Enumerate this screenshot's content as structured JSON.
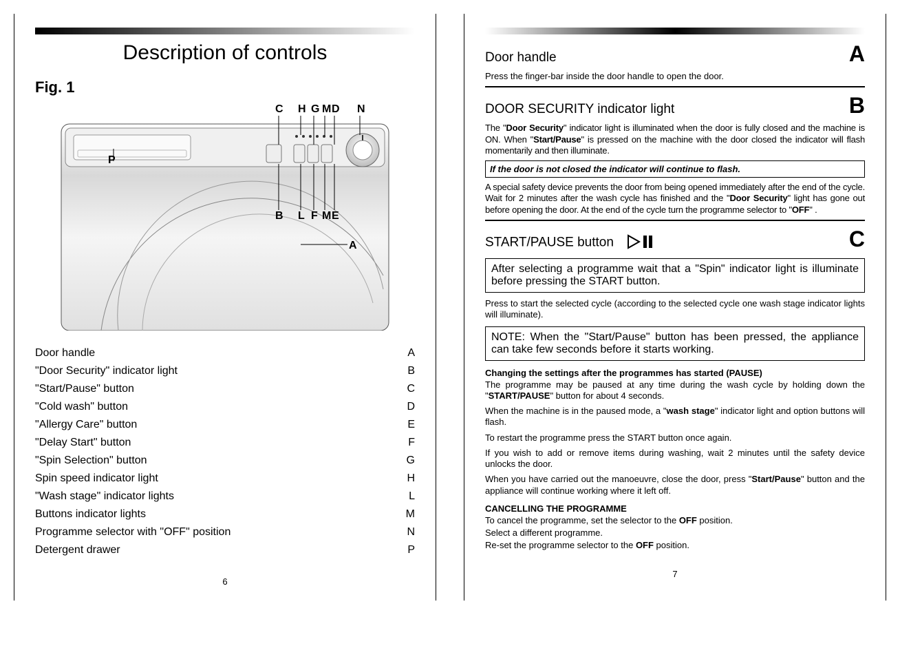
{
  "left": {
    "title": "Description of controls",
    "fig": "Fig. 1",
    "callouts_top": [
      "C",
      "H",
      "G",
      "M",
      "D",
      "N"
    ],
    "callouts_bottom": [
      "B",
      "L",
      "F",
      "M",
      "E"
    ],
    "callout_p": "P",
    "callout_a": "A",
    "legend": [
      {
        "label": "Door handle",
        "k": "A"
      },
      {
        "label": "\"Door Security\" indicator light",
        "k": "B"
      },
      {
        "label": "\"Start/Pause\" button",
        "k": "C"
      },
      {
        "label": "\"Cold wash\" button",
        "k": "D"
      },
      {
        "label": "\"Allergy Care\" button",
        "k": "E"
      },
      {
        "label": "\"Delay Start\" button",
        "k": "F"
      },
      {
        "label": "\"Spin Selection\" button",
        "k": "G"
      },
      {
        "label": "Spin speed indicator light",
        "k": "H"
      },
      {
        "label": "\"Wash stage\" indicator lights",
        "k": "L"
      },
      {
        "label": "Buttons indicator lights",
        "k": "M"
      },
      {
        "label": "Programme selector with \"OFF\" position",
        "k": "N"
      },
      {
        "label": "Detergent drawer",
        "k": "P"
      }
    ],
    "pagenum": "6"
  },
  "right": {
    "sectionA": {
      "title": "Door handle",
      "letter": "A",
      "text": "Press the finger-bar inside the door handle to open the door."
    },
    "sectionB": {
      "title": "DOOR SECURITY indicator light",
      "letter": "B",
      "para1_a": "The \"",
      "para1_b": "Door Security",
      "para1_c": "\" indicator light is illuminated when the door is fully closed and the machine is ON. When \"",
      "para1_d": "Start/Pause",
      "para1_e": "\" is pressed on the machine with the door closed the indicator will flash momentarily and then illuminate.",
      "boxnote": "If the door is not closed the indicator will continue to flash.",
      "para2_a": "A special safety device prevents the door from being opened immediately after the end of the cycle. Wait for 2 minutes after the wash cycle has finished and the \"",
      "para2_b": "Door Security",
      "para2_c": "\" light has gone out before opening the door. At the end of the cycle turn the programme selector to \"",
      "para2_d": "OFF",
      "para2_e": "\" ."
    },
    "sectionC": {
      "title": "START/PAUSE button",
      "letter": "C",
      "box1": "After selecting a programme wait that a  \"Spin\" indicator light is illuminate before pressing the START button.",
      "para1": "Press to start the selected cycle (according to the selected cycle one wash stage indicator lights will illuminate).",
      "box2": "NOTE: When the \"Start/Pause\" button has been pressed, the appliance can take few seconds before it starts working.",
      "sub1": "Changing the settings after the programmes has started (PAUSE)",
      "p1_a": "The programme may be paused at any time during the wash cycle by holding down the \"",
      "p1_b": "START/PAUSE",
      "p1_c": "\" button for about 4 seconds.",
      "p2_a": "When the machine is in the paused mode, a \"",
      "p2_b": "wash stage",
      "p2_c": "\" indicator light and option buttons will flash.",
      "p3": "To restart the programme press the START button once again.",
      "p4": "If you wish to add or remove items during washing, wait 2 minutes until the safety device unlocks the door.",
      "p5_a": "When you have carried out the manoeuvre, close the door, press \"",
      "p5_b": "Start/Pause",
      "p5_c": "\" button and the appliance will continue working where it left off.",
      "sub2": "CANCELLING THE PROGRAMME",
      "c1_a": "To cancel the programme, set the selector to the ",
      "c1_b": "OFF",
      "c1_c": " position.",
      "c2": "Select a different programme.",
      "c3_a": "Re-set the programme selector to the ",
      "c3_b": "OFF",
      "c3_c": " position."
    },
    "pagenum": "7"
  }
}
